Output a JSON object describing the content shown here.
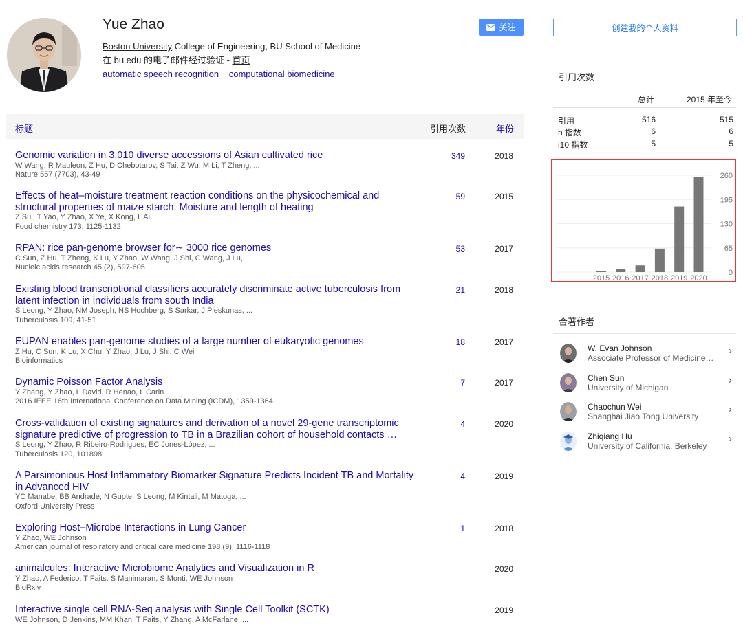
{
  "profile": {
    "name": "Yue Zhao",
    "affiliation_org": "Boston University",
    "affiliation_rest": " College of Engineering, BU School of Medicine",
    "email_prefix": "在 bu.edu 的电子邮件经过验证 - ",
    "homepage": "首页",
    "interests": [
      "automatic speech recognition",
      "computational biomedicine"
    ],
    "follow_label": "关注"
  },
  "table": {
    "header_title": "标题",
    "header_cited": "引用次数",
    "header_year": "年份",
    "rows": [
      {
        "title": "Genomic variation in 3,010 diverse accessions of Asian cultivated rice",
        "authors": "W Wang, R Mauleon, Z Hu, D Chebotarov, S Tai, Z Wu, M Li, T Zheng, ...",
        "venue": "Nature 557 (7703), 43-49",
        "cited": "349",
        "year": "2018"
      },
      {
        "title": "Effects of heat–moisture treatment reaction conditions on the physicochemical and structural properties of maize starch: Moisture and length of heating",
        "authors": "Z Sui, T Yao, Y Zhao, X Ye, X Kong, L Ai",
        "venue": "Food chemistry 173, 1125-1132",
        "cited": "59",
        "year": "2015"
      },
      {
        "title": "RPAN: rice pan-genome browser for∼ 3000 rice genomes",
        "authors": "C Sun, Z Hu, T Zheng, K Lu, Y Zhao, W Wang, J Shi, C Wang, J Lu, ...",
        "venue": "Nucleic acids research 45 (2), 597-605",
        "cited": "53",
        "year": "2017"
      },
      {
        "title": "Existing blood transcriptional classifiers accurately discriminate active tuberculosis from latent infection in individuals from south India",
        "authors": "S Leong, Y Zhao, NM Joseph, NS Hochberg, S Sarkar, J Pleskunas, ...",
        "venue": "Tuberculosis 109, 41-51",
        "cited": "21",
        "year": "2018"
      },
      {
        "title": "EUPAN enables pan-genome studies of a large number of eukaryotic genomes",
        "authors": "Z Hu, C Sun, K Lu, X Chu, Y Zhao, J Lu, J Shi, C Wei",
        "venue": "Bioinformatics",
        "cited": "18",
        "year": "2017"
      },
      {
        "title": "Dynamic Poisson Factor Analysis",
        "authors": "Y Zhang, Y Zhao, L David, R Henao, L Carin",
        "venue": "2016 IEEE 16th International Conference on Data Mining (ICDM), 1359-1364",
        "cited": "7",
        "year": "2017"
      },
      {
        "title": "Cross-validation of existing signatures and derivation of a novel 29-gene transcriptomic signature predictive of progression to TB in a Brazilian cohort of household contacts …",
        "authors": "S Leong, Y Zhao, R Ribeiro-Rodrigues, EC Jones-López, ...",
        "venue": "Tuberculosis 120, 101898",
        "cited": "4",
        "year": "2020"
      },
      {
        "title": "A Parsimonious Host Inflammatory Biomarker Signature Predicts Incident TB and Mortality in Advanced HIV",
        "authors": "YC Manabe, BB Andrade, N Gupte, S Leong, M Kintali, M Matoga, ...",
        "venue": "Oxford University Press",
        "cited": "4",
        "year": "2019"
      },
      {
        "title": "Exploring Host–Microbe Interactions in Lung Cancer",
        "authors": "Y Zhao, WE Johnson",
        "venue": "American journal of respiratory and critical care medicine 198 (9), 1116-1118",
        "cited": "1",
        "year": "2018"
      },
      {
        "title": "animalcules: Interactive Microbiome Analytics and Visualization in R",
        "authors": "Y Zhao, A Federico, T Faits, S Manimaran, S Monti, WE Johnson",
        "venue": "BioRxiv",
        "cited": "",
        "year": "2020"
      },
      {
        "title": "Interactive single cell RNA-Seq analysis with Single Cell Toolkit (SCTK)",
        "authors": "WE Johnson, D Jenkins, MM Khan, T Faits, Y Zhang, A McFarlane, ...",
        "venue": "",
        "cited": "",
        "year": "2019"
      }
    ]
  },
  "sidebar": {
    "create_label": "创建我的个人资料",
    "citations_title": "引用次数",
    "col_total": "总计",
    "col_since": "2015 年至今",
    "stats": [
      {
        "label": "引用",
        "total": "516",
        "since": "515"
      },
      {
        "label": "h 指数",
        "total": "6",
        "since": "6"
      },
      {
        "label": "i10 指数",
        "total": "5",
        "since": "5"
      }
    ],
    "coauthors_title": "合著作者",
    "coauthors": [
      {
        "name": "W. Evan Johnson",
        "affiliation": "Associate Professor of Medicine and Biostatistics, Boston University"
      },
      {
        "name": "Chen Sun",
        "affiliation": "University of Michigan"
      },
      {
        "name": "Chaochun Wei",
        "affiliation": "Shanghai Jiao Tong University"
      },
      {
        "name": "Zhiqiang Hu",
        "affiliation": "University of California, Berkeley"
      }
    ]
  },
  "chart_data": {
    "type": "bar",
    "categories": [
      "2015",
      "2016",
      "2017",
      "2018",
      "2019",
      "2020"
    ],
    "values": [
      2,
      9,
      18,
      63,
      176,
      255
    ],
    "ylim": [
      0,
      260
    ],
    "yticks": [
      "260",
      "195",
      "130",
      "65",
      "0"
    ],
    "bar_color": "#777777",
    "grid": true
  }
}
